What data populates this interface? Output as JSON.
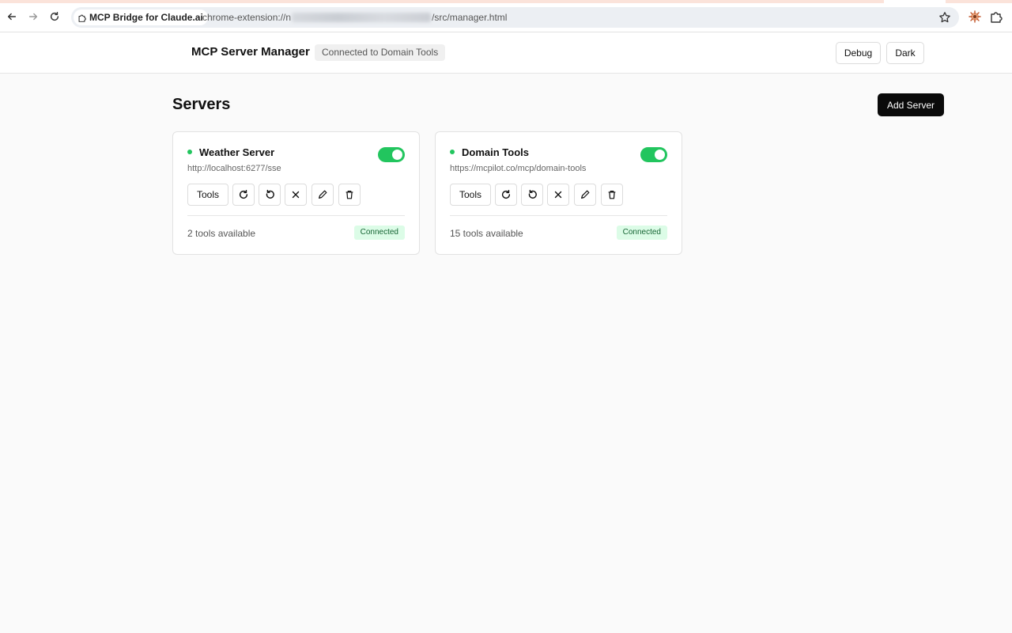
{
  "browser": {
    "site_chip_label": "MCP Bridge for Claude.ai",
    "url_prefix": "chrome-extension://",
    "url_first_char": "n",
    "url_suffix": "/src/manager.html",
    "icons": [
      "back-arrow-icon",
      "forward-arrow-icon",
      "reload-icon",
      "puzzle-piece-icon",
      "star-icon",
      "extension-icon"
    ]
  },
  "header": {
    "title": "MCP Server Manager",
    "connection_badge": "Connected to Domain Tools",
    "debug_label": "Debug",
    "theme_label": "Dark"
  },
  "main": {
    "section_title": "Servers",
    "add_server_label": "Add Server",
    "servers": [
      {
        "name": "Weather Server",
        "url": "http://localhost:6277/sse",
        "enabled": true,
        "tools_label": "Tools",
        "tools_count": "2 tools available",
        "status": "Connected"
      },
      {
        "name": "Domain Tools",
        "url": "https://mcpilot.co/mcp/domain-tools",
        "enabled": true,
        "tools_label": "Tools",
        "tools_count": "15 tools available",
        "status": "Connected"
      }
    ],
    "card_actions": [
      "refresh-icon",
      "undo-icon",
      "close-icon",
      "pencil-icon",
      "trash-icon"
    ]
  },
  "colors": {
    "accent_green": "#22c55e",
    "status_pill_bg": "#dcfce7",
    "status_pill_text": "#166534",
    "primary_button": "#0a0a0a",
    "page_bg": "#fafafa"
  }
}
